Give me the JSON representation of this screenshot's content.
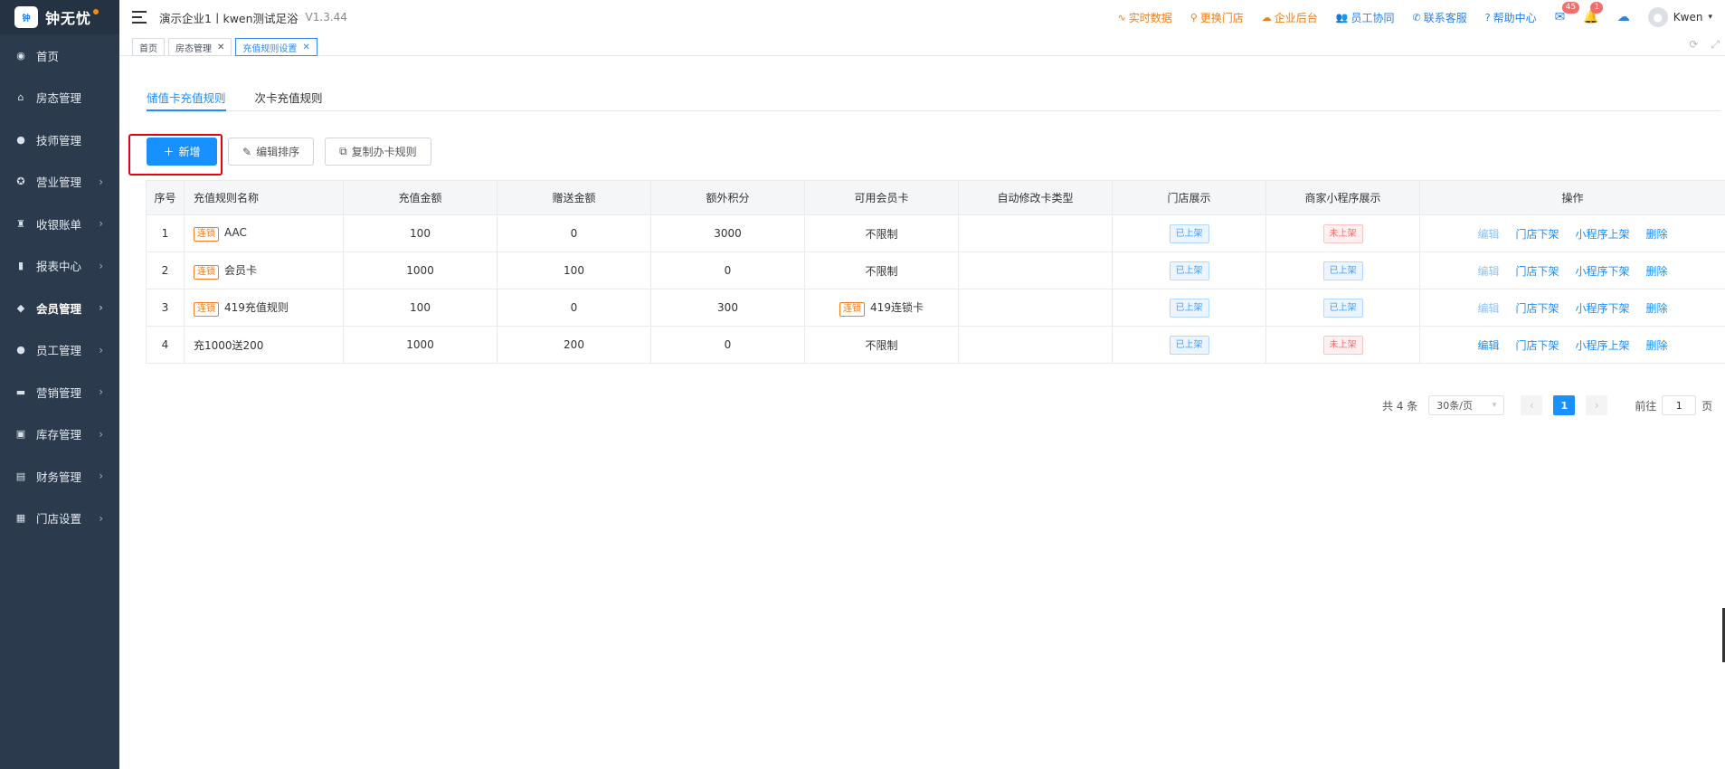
{
  "brand": {
    "logo_mark": "钟无忧",
    "name": "钟无忧"
  },
  "sidebar": {
    "items": [
      {
        "label": "首页",
        "icon": "dashboard-icon",
        "glyph": "◉",
        "arrow": false
      },
      {
        "label": "房态管理",
        "icon": "home-icon",
        "glyph": "⌂",
        "arrow": false
      },
      {
        "label": "技师管理",
        "icon": "person-icon",
        "glyph": "●",
        "arrow": false
      },
      {
        "label": "营业管理",
        "icon": "target-icon",
        "glyph": "✪",
        "arrow": true
      },
      {
        "label": "收银账单",
        "icon": "moneybag-icon",
        "glyph": "♜",
        "arrow": true
      },
      {
        "label": "报表中心",
        "icon": "bar-chart-icon",
        "glyph": "▮",
        "arrow": true
      },
      {
        "label": "会员管理",
        "icon": "diamond-icon",
        "glyph": "◆",
        "arrow": true,
        "active": true
      },
      {
        "label": "员工管理",
        "icon": "user-icon",
        "glyph": "●",
        "arrow": true
      },
      {
        "label": "营销管理",
        "icon": "briefcase-icon",
        "glyph": "▬",
        "arrow": true
      },
      {
        "label": "库存管理",
        "icon": "cube-icon",
        "glyph": "▣",
        "arrow": true
      },
      {
        "label": "财务管理",
        "icon": "wallet-icon",
        "glyph": "▤",
        "arrow": true
      },
      {
        "label": "门店设置",
        "icon": "grid-icon",
        "glyph": "▦",
        "arrow": true
      }
    ]
  },
  "header": {
    "company": "演示企业1丨kwen测试足浴",
    "version": "V1.3.44",
    "links": [
      {
        "label": "实时数据",
        "icon": "realtime-icon",
        "glyph": "∿",
        "color": "orange"
      },
      {
        "label": "更换门店",
        "icon": "search-icon",
        "glyph": "⚲",
        "color": "orange"
      },
      {
        "label": "企业后台",
        "icon": "cloud-icon",
        "glyph": "☁",
        "color": "orange"
      },
      {
        "label": "员工协同",
        "icon": "team-icon",
        "glyph": "👥",
        "color": "blue"
      },
      {
        "label": "联系客服",
        "icon": "phone-icon",
        "glyph": "✆",
        "color": "blue"
      },
      {
        "label": "帮助中心",
        "icon": "help-icon",
        "glyph": "?",
        "color": "blue"
      }
    ],
    "mail_badge": "45",
    "bell_badge": "1",
    "user_name": "Kwen"
  },
  "tabs": [
    {
      "label": "首页",
      "closable": false,
      "active": false
    },
    {
      "label": "房态管理",
      "closable": true,
      "active": false
    },
    {
      "label": "充值规则设置",
      "closable": true,
      "active": true
    }
  ],
  "sub_tabs": [
    {
      "label": "储值卡充值规则",
      "active": true
    },
    {
      "label": "次卡充值规则",
      "active": false
    }
  ],
  "toolbar": {
    "add": "新增",
    "sort": "编辑排序",
    "copy": "复制办卡规则"
  },
  "table": {
    "columns": [
      "序号",
      "充值规则名称",
      "充值金额",
      "赠送金额",
      "额外积分",
      "可用会员卡",
      "自动修改卡类型",
      "门店展示",
      "商家小程序展示",
      "操作"
    ],
    "rows": [
      {
        "index": "1",
        "tag": "连锁",
        "name": "AAC",
        "amount": "100",
        "gift": "0",
        "points": "3000",
        "card_tag": "",
        "card": "不限制",
        "auto": "",
        "store": "已上架",
        "store_on": true,
        "mini": "未上架",
        "mini_on": false,
        "edit_disabled": true,
        "ops": [
          "编辑",
          "门店下架",
          "小程序上架",
          "删除"
        ]
      },
      {
        "index": "2",
        "tag": "连锁",
        "name": "会员卡",
        "amount": "1000",
        "gift": "100",
        "points": "0",
        "card_tag": "",
        "card": "不限制",
        "auto": "",
        "store": "已上架",
        "store_on": true,
        "mini": "已上架",
        "mini_on": true,
        "edit_disabled": true,
        "ops": [
          "编辑",
          "门店下架",
          "小程序下架",
          "删除"
        ]
      },
      {
        "index": "3",
        "tag": "连锁",
        "name": "419充值规则",
        "amount": "100",
        "gift": "0",
        "points": "300",
        "card_tag": "连锁",
        "card": "419连锁卡",
        "auto": "",
        "store": "已上架",
        "store_on": true,
        "mini": "已上架",
        "mini_on": true,
        "edit_disabled": true,
        "ops": [
          "编辑",
          "门店下架",
          "小程序下架",
          "删除"
        ]
      },
      {
        "index": "4",
        "tag": "",
        "name": "充1000送200",
        "amount": "1000",
        "gift": "200",
        "points": "0",
        "card_tag": "",
        "card": "不限制",
        "auto": "",
        "store": "已上架",
        "store_on": true,
        "mini": "未上架",
        "mini_on": false,
        "edit_disabled": false,
        "ops": [
          "编辑",
          "门店下架",
          "小程序上架",
          "删除"
        ]
      }
    ]
  },
  "pagination": {
    "total": "共 4 条",
    "page_size": "30条/页",
    "current": "1",
    "goto_label": "前往",
    "goto_value": "1",
    "page_unit": "页"
  },
  "colors": {
    "primary": "#1890ff",
    "accent": "#f07e19",
    "sidebar": "#2b3a4d",
    "highlight": "#e60012"
  }
}
